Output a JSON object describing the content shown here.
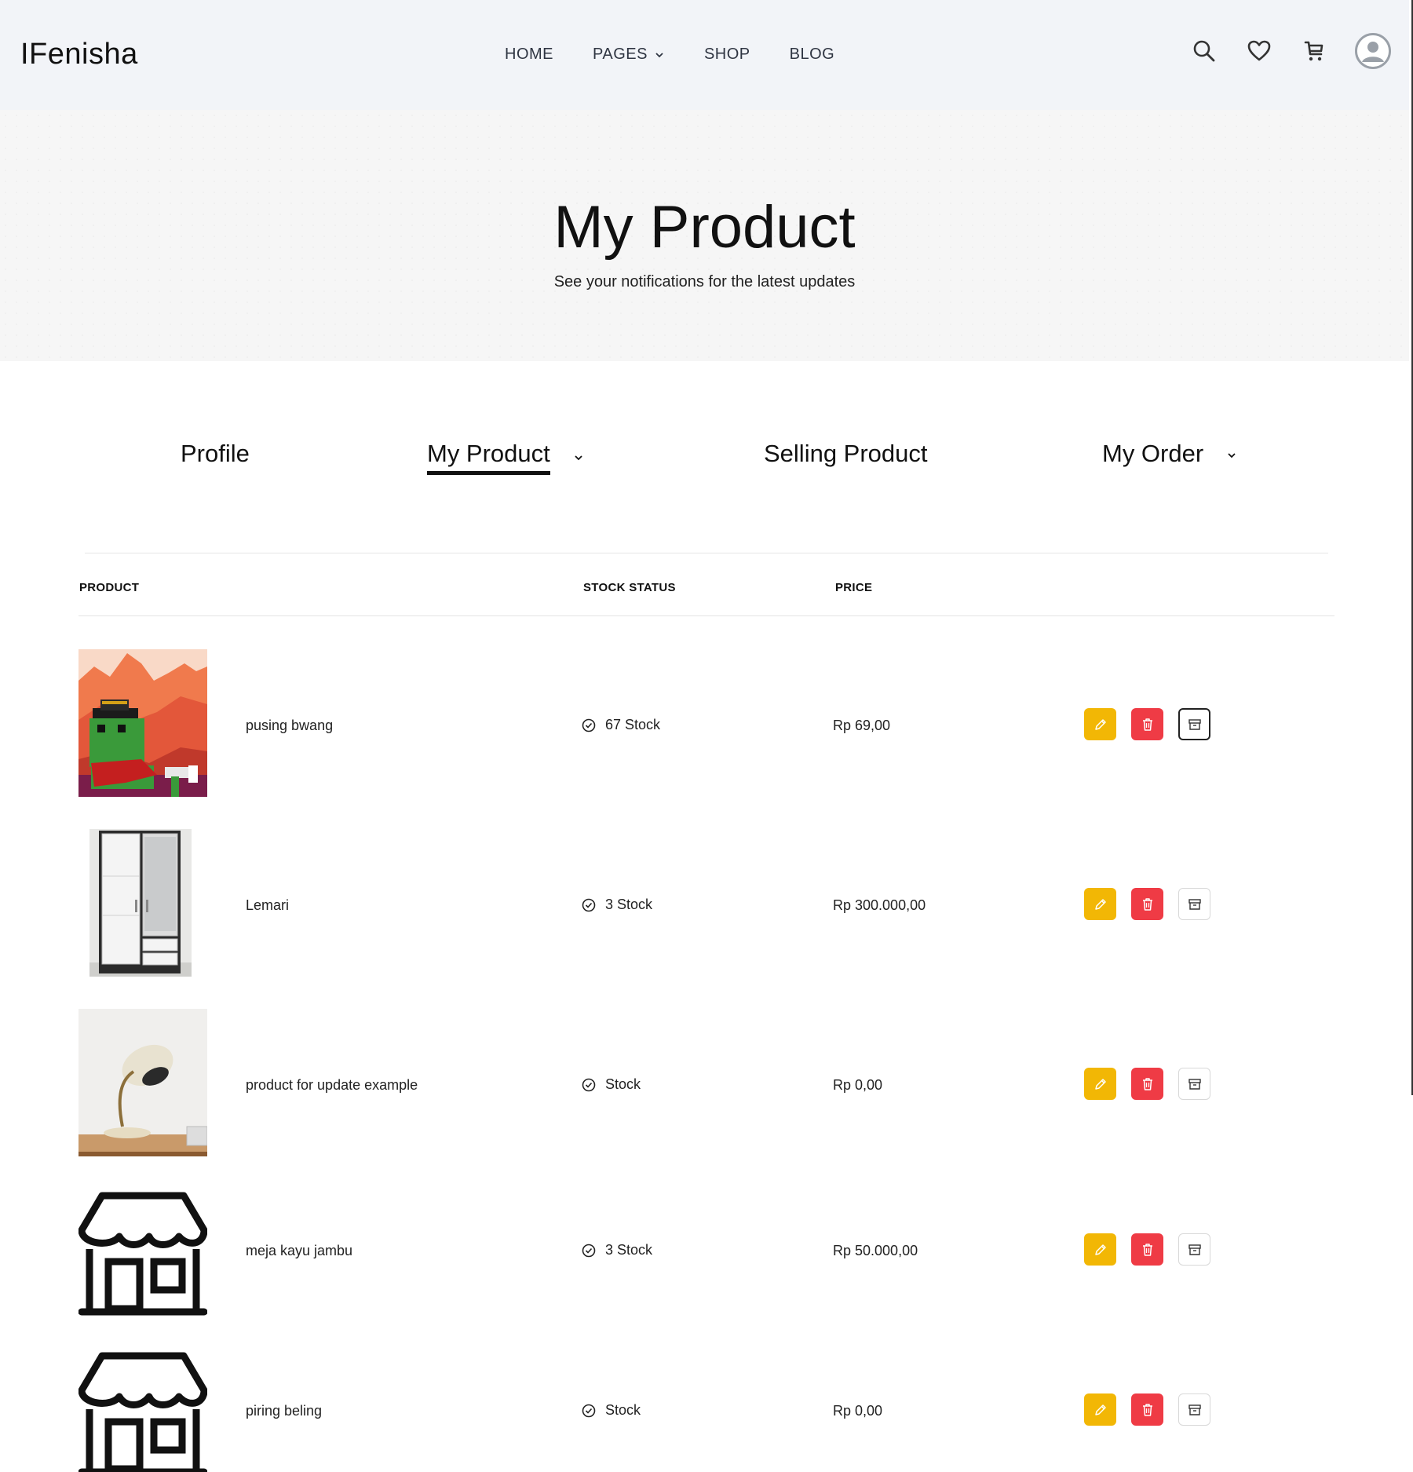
{
  "brand": "IFenisha",
  "nav": {
    "home": "HOME",
    "pages": "PAGES",
    "shop": "SHOP",
    "blog": "BLOG"
  },
  "hero": {
    "title": "My Product",
    "subtitle": "See your notifications for the latest updates"
  },
  "tabs": {
    "profile": "Profile",
    "my_product": "My Product",
    "selling_product": "Selling Product",
    "my_order": "My Order"
  },
  "table": {
    "headers": {
      "product": "PRODUCT",
      "stock_status": "STOCK STATUS",
      "price": "PRICE"
    },
    "rows": [
      {
        "name": "pusing bwang",
        "stock": "67 Stock",
        "price": "Rp 69,00",
        "image": "pixel-art-frog-cowboy"
      },
      {
        "name": "Lemari",
        "stock": "3 Stock",
        "price": "Rp 300.000,00",
        "image": "wardrobe-photo"
      },
      {
        "name": "product for update example",
        "stock": "Stock",
        "price": "Rp 0,00",
        "image": "desk-lamp-photo"
      },
      {
        "name": "meja kayu jambu",
        "stock": "3 Stock",
        "price": "Rp 50.000,00",
        "image": "store-icon"
      },
      {
        "name": "piring beling",
        "stock": "Stock",
        "price": "Rp 0,00",
        "image": "store-icon"
      }
    ]
  },
  "colors": {
    "edit_button": "#f2b705",
    "delete_button": "#ef3b45",
    "header_bg": "#f2f4f8"
  }
}
